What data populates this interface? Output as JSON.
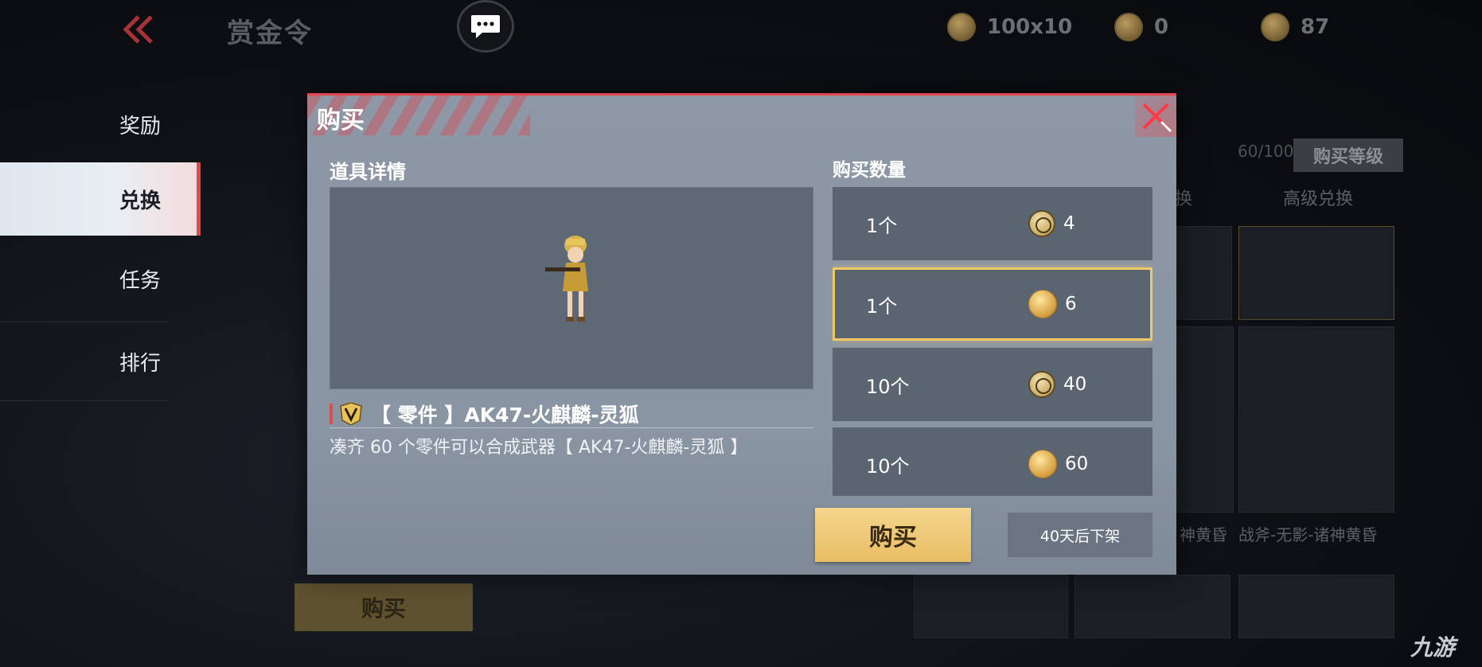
{
  "header": {
    "title": "赏金令",
    "currencies": [
      {
        "icon": "bounty-token-icon",
        "value": "100x10"
      },
      {
        "icon": "silver-coin-icon",
        "value": "0"
      },
      {
        "icon": "gold-coin-icon",
        "value": "87"
      }
    ]
  },
  "sidebar": {
    "items": [
      {
        "label": "奖励",
        "active": false
      },
      {
        "label": "兑换",
        "active": true
      },
      {
        "label": "任务",
        "active": false
      },
      {
        "label": "排行",
        "active": false
      }
    ]
  },
  "background": {
    "level": "60/100",
    "buy_level_label": "购买等级",
    "tab_partial": "换",
    "tab_advanced": "高级兑换",
    "item_name_1": "神黄昏",
    "item_name_2": "战斧-无影-诸神黄昏",
    "buy_label": "购买",
    "card_count": "3"
  },
  "modal": {
    "title": "购买",
    "detail_label": "道具详情",
    "quantity_label": "购买数量",
    "item": {
      "name": "【 零件 】AK47-火麒麟-灵狐",
      "description": "凑齐 60 个零件可以合成武器【 AK47-火麒麟-灵狐 】"
    },
    "options": [
      {
        "qty": "1个",
        "currency": "silver",
        "price": "4",
        "selected": false
      },
      {
        "qty": "1个",
        "currency": "gold",
        "price": "6",
        "selected": true
      },
      {
        "qty": "10个",
        "currency": "silver",
        "price": "40",
        "selected": false
      },
      {
        "qty": "10个",
        "currency": "gold",
        "price": "60",
        "selected": false
      }
    ],
    "buy_label": "购买",
    "delist_label": "40天后下架"
  },
  "watermark": "九游",
  "colors": {
    "accent_red": "#e04b4b",
    "gold_button": "#f4d58d",
    "selected_border": "#f0c866",
    "modal_bg": "#8d97a5"
  }
}
